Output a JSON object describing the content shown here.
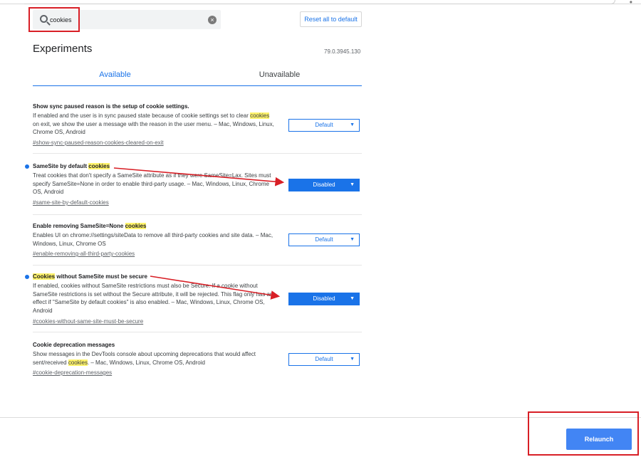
{
  "search": {
    "value": "cookies"
  },
  "toolbar": {
    "reset_label": "Reset all to default"
  },
  "header": {
    "title": "Experiments",
    "version": "79.0.3945.130"
  },
  "tabs": [
    {
      "label": "Available"
    },
    {
      "label": "Unavailable"
    }
  ],
  "experiments": [
    {
      "title": "Show sync paused reason is the setup of cookie settings.",
      "desc_pre": "If enabled and the user is in sync paused state because of cookie settings set to clear ",
      "desc_hl": "cookies",
      "desc_post": " on exit, we show the user a message with the reason in the user menu. – Mac, Windows, Linux, Chrome OS, Android",
      "link": "#show-sync-paused-reason-cookies-cleared-on-exit",
      "select": "Default"
    },
    {
      "title_pre": "SameSite by default ",
      "title_hl": "cookies",
      "desc": "Treat cookies that don't specify a SameSite attribute as if they were SameSite=Lax. Sites must specify SameSite=None in order to enable third-party usage. – Mac, Windows, Linux, Chrome OS, Android",
      "link": "#same-site-by-default-cookies",
      "select": "Disabled"
    },
    {
      "title_pre": "Enable removing SameSite=None ",
      "title_hl": "cookies",
      "desc": "Enables UI on chrome://settings/siteData to remove all third-party cookies and site data. – Mac, Windows, Linux, Chrome OS",
      "link": "#enable-removing-all-third-party-cookies",
      "select": "Default"
    },
    {
      "title_hl": "Cookies",
      "title_post": " without SameSite must be secure",
      "desc": "If enabled, cookies without SameSite restrictions must also be Secure. If a cookie without SameSite restrictions is set without the Secure attribute, it will be rejected. This flag only has an effect if \"SameSite by default cookies\" is also enabled. – Mac, Windows, Linux, Chrome OS, Android",
      "link": "#cookies-without-same-site-must-be-secure",
      "select": "Disabled"
    },
    {
      "title": "Cookie deprecation messages",
      "desc_pre": "Show messages in the DevTools console about upcoming deprecations that would affect sent/received ",
      "desc_hl": "cookies",
      "desc_post": ". – Mac, Windows, Linux, Chrome OS, Android",
      "link": "#cookie-deprecation-messages",
      "select": "Default"
    }
  ],
  "footer": {
    "relaunch_label": "Relaunch"
  },
  "colors": {
    "accent": "#1a73e8",
    "highlight": "#fff36b",
    "annotation": "#d81f26",
    "relaunch": "#4285f4"
  }
}
